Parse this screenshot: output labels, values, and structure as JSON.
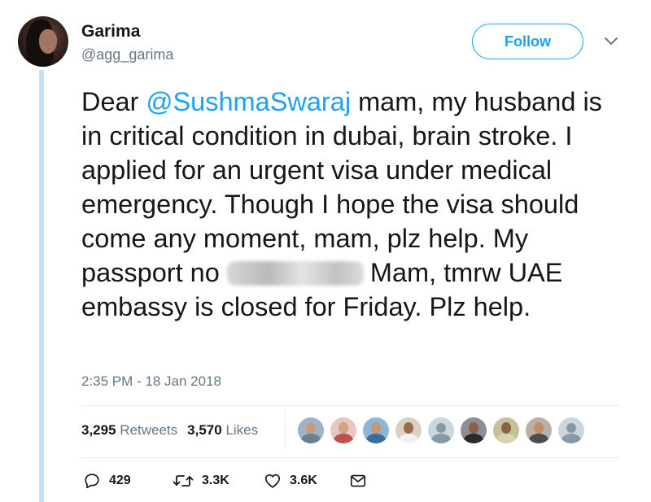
{
  "author": {
    "name": "Garima",
    "handle": "@agg_garima"
  },
  "follow_label": "Follow",
  "tweet": {
    "text_before_mention": "Dear ",
    "mention": "@SushmaSwaraj",
    "text_after_mention": " mam, my husband is in critical condition in dubai, brain stroke. I applied for an urgent visa under medical emergency. Though I hope the visa should come any moment, mam, plz help. My passport no ",
    "text_after_redaction": "Mam, tmrw UAE embassy is closed for Friday. Plz help."
  },
  "timestamp": "2:35 PM - 18 Jan 2018",
  "stats": {
    "retweets_count": "3,295",
    "retweets_label": "Retweets",
    "likes_count": "3,570",
    "likes_label": "Likes"
  },
  "liked_by_avatars": [
    {
      "kind": "photo",
      "bg": "#9fb3c8",
      "skin": "#c89a7b",
      "body": "#6d7f95"
    },
    {
      "kind": "photo",
      "bg": "#e7c6c0",
      "skin": "#d3a183",
      "body": "#c0504d"
    },
    {
      "kind": "photo",
      "bg": "#8ab7d6",
      "skin": "#c99573",
      "body": "#3a6f9c"
    },
    {
      "kind": "photo",
      "bg": "#d9d2c3",
      "skin": "#9a6b4d",
      "body": "#f2f2f2"
    },
    {
      "kind": "default"
    },
    {
      "kind": "photo",
      "bg": "#8a8f96",
      "skin": "#8d5f45",
      "body": "#2a2a2a"
    },
    {
      "kind": "photo",
      "bg": "#c7c19a",
      "skin": "#8a6247",
      "body": "#d9d3b5"
    },
    {
      "kind": "photo",
      "bg": "#b9b1a8",
      "skin": "#c38d6c",
      "body": "#4d4d4d"
    },
    {
      "kind": "default"
    }
  ],
  "actions": {
    "reply_count": "429",
    "retweet_count": "3.3K",
    "like_count": "3.6K"
  },
  "colors": {
    "accent": "#1da1f2",
    "secondary_text": "#657786",
    "thread_line": "#c4e1f6"
  }
}
